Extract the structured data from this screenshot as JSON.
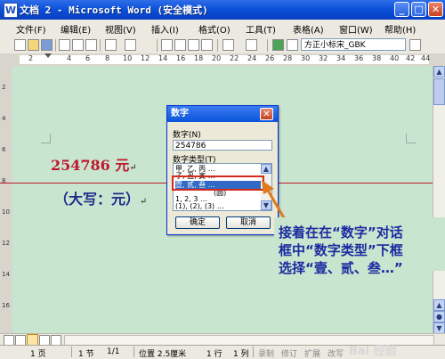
{
  "window": {
    "title": "文档 2 - Microsoft Word (安全模式)",
    "app_icon": "W",
    "minimize": "_",
    "maximize": "□",
    "close": "✕"
  },
  "menu": [
    "文件(F)",
    "编辑(E)",
    "视图(V)",
    "插入(I)",
    "格式(O)",
    "工具(T)",
    "表格(A)",
    "窗口(W)",
    "帮助(H)"
  ],
  "toolbar": {
    "font_name": "方正小标宋_GBK"
  },
  "ruler": {
    "ticks": [
      "2",
      "4",
      "6",
      "8",
      "10",
      "12",
      "14",
      "16",
      "18",
      "20",
      "22",
      "24",
      "26",
      "28",
      "30",
      "32",
      "34",
      "36",
      "38",
      "40",
      "42",
      "44"
    ]
  },
  "vruler": {
    "ticks": [
      "2",
      "4",
      "6",
      "8",
      "10",
      "12",
      "14",
      "16"
    ]
  },
  "document": {
    "amount": "254786 元",
    "amount_mark": "↵",
    "uppercase_line": "（大写：元）",
    "uppercase_mark": "↵"
  },
  "dialog": {
    "title": "数字",
    "close": "✕",
    "number_label": "数字(N)",
    "number_value": "254786",
    "type_label": "数字类型(T)",
    "types": [
      "甲, 乙, 丙 …",
      "子, 丑, 寅 …",
      "壹, 贰, 叁 …",
      "(圆)",
      "1, 2, 3 …",
      "(1), (2), (3) …"
    ],
    "selected_index": 2,
    "ok": "确定",
    "cancel": "取消"
  },
  "annotation": {
    "line1": "接着在在“数字”对话",
    "line2": "框中“数字类型”下框",
    "line3": "选择“壹、贰、叁…”"
  },
  "status": {
    "page": "1 页",
    "section": "1 节",
    "count": "1/1",
    "position": "位置 2.5厘米",
    "line": "1 行",
    "column": "1 列",
    "rec": "录制",
    "trk": "修订",
    "ext": "扩展",
    "ovr": "改写"
  },
  "watermark": "Bai 经验",
  "colors": {
    "doc_bg": "#c8e6cf",
    "amount": "#c0172e",
    "annotation": "#1c2aa0",
    "highlight": "#d42a1c",
    "selection": "#316ac5"
  }
}
